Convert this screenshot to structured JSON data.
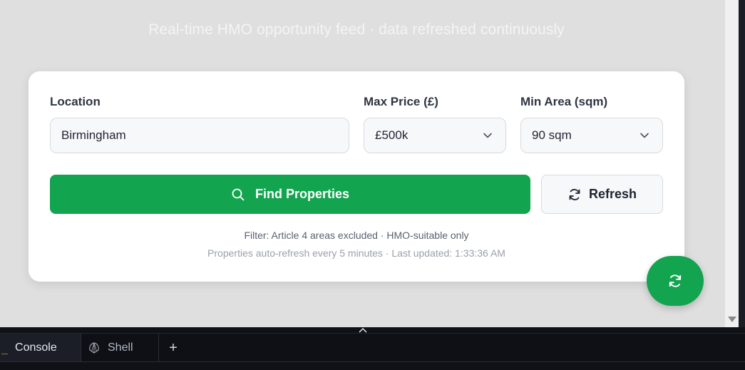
{
  "subtitle": "Real-time HMO opportunity feed · data refreshed continuously",
  "search": {
    "location_label": "Location",
    "location_value": "Birmingham",
    "max_price_label": "Max Price (£)",
    "max_price_value": "£500k",
    "min_area_label": "Min Area (sqm)",
    "min_area_value": "90 sqm",
    "find_label": "Find Properties",
    "refresh_label": "Refresh",
    "filter_note": "Filter: Article 4 areas excluded · HMO-suitable only",
    "refresh_note": "Properties auto-refresh every 5 minutes · Last updated: 1:33:36 AM"
  },
  "tabs": [
    {
      "label": "Console",
      "icon": "console-icon"
    },
    {
      "label": "Shell",
      "icon": "shell-icon"
    }
  ],
  "colors": {
    "accent": "#12a44f",
    "page_bg": "#dfdfdf"
  }
}
